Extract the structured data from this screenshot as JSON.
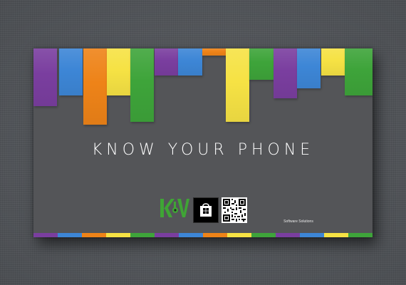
{
  "card": {
    "title": "KNOW YOUR PHONE",
    "publisher_caption": "Software Solutions",
    "publisher_logo_letters": "K&V"
  },
  "palette": {
    "purple": "#7a3e9f",
    "blue": "#3d86d6",
    "orange": "#ee8318",
    "yellow": "#f6e244",
    "green": "#3ea43a",
    "card_background": "#545558"
  },
  "bar_colors": [
    "purple",
    "blue",
    "orange",
    "yellow",
    "green",
    "purple",
    "blue",
    "orange",
    "yellow",
    "green",
    "purple",
    "blue",
    "yellow",
    "green"
  ],
  "stripe_colors": [
    "purple",
    "blue",
    "orange",
    "yellow",
    "green",
    "purple",
    "blue",
    "orange",
    "yellow",
    "green",
    "purple",
    "blue",
    "yellow",
    "green"
  ],
  "icons": [
    "kv-software-logo-icon",
    "windows-store-icon",
    "qr-code-icon"
  ]
}
